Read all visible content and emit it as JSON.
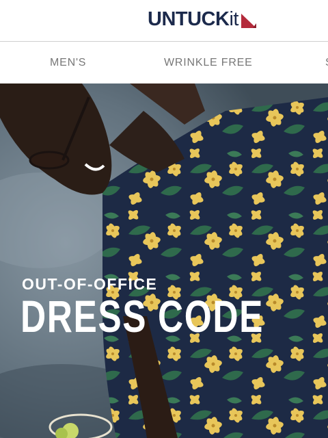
{
  "header": {
    "logo_upper": "UNTUCK",
    "logo_lower": "it"
  },
  "nav": {
    "items": [
      {
        "label": "MEN'S"
      },
      {
        "label": "WRINKLE FREE"
      },
      {
        "label": "S"
      }
    ]
  },
  "hero": {
    "eyebrow": "OUT-OF-OFFICE",
    "headline": "DRESS CODE"
  },
  "colors": {
    "brand_navy": "#1c2a4c",
    "brand_red": "#b42a3b",
    "nav_text": "#777777",
    "shirt_navy": "#1d2a45",
    "flower_yellow": "#e8c65a",
    "leaf_green": "#2f6a4c"
  }
}
